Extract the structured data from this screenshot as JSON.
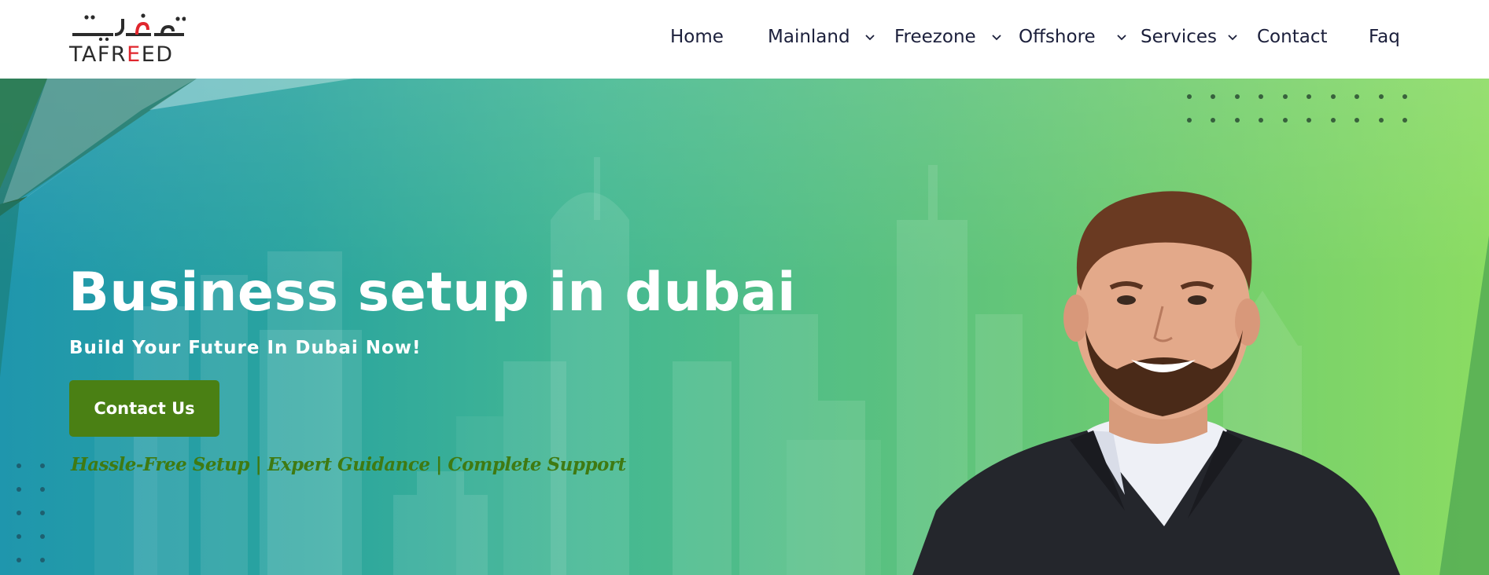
{
  "brand": {
    "logo_arabic": "تـفـريـد",
    "logo_english_part1": "TAFR",
    "logo_english_part2": "E",
    "logo_english_part3": "ED",
    "accent_red": "#e0262d"
  },
  "nav": {
    "items": [
      {
        "label": "Home",
        "has_dropdown": false
      },
      {
        "label": "Mainland",
        "has_dropdown": true
      },
      {
        "label": "Freezone",
        "has_dropdown": true
      },
      {
        "label": "Offshore",
        "has_dropdown": true
      },
      {
        "label": "Services",
        "has_dropdown": true
      },
      {
        "label": "Contact",
        "has_dropdown": false
      },
      {
        "label": "Faq",
        "has_dropdown": false
      }
    ],
    "dropdown_icon": "chevron-down-icon"
  },
  "hero": {
    "title": "Business setup in dubai",
    "subtitle": "Build Your Future In Dubai Now!",
    "cta_label": "Contact Us",
    "tagline": "Hassle-Free Setup | Expert Guidance | Complete Support",
    "cta_color": "#4a8014",
    "tagline_color": "#3f7a12"
  }
}
